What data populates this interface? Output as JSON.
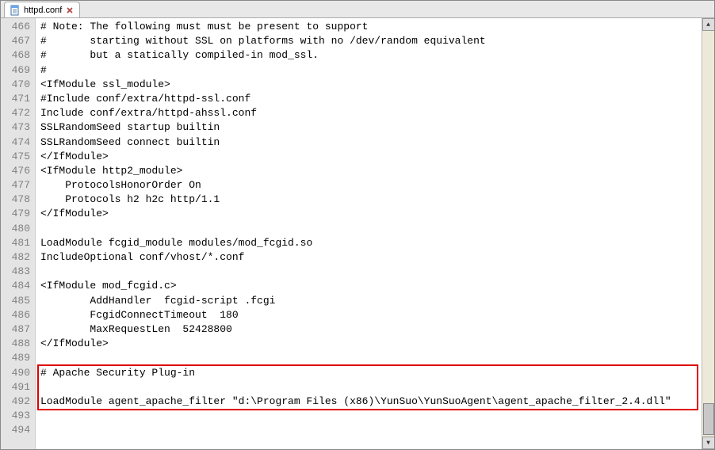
{
  "tab": {
    "filename": "httpd.conf"
  },
  "editor": {
    "first_line": 466,
    "highlight": {
      "from": 490,
      "to": 492
    },
    "lines": [
      "# Note: The following must must be present to support",
      "#       starting without SSL on platforms with no /dev/random equivalent",
      "#       but a statically compiled-in mod_ssl.",
      "#",
      "<IfModule ssl_module>",
      "#Include conf/extra/httpd-ssl.conf",
      "Include conf/extra/httpd-ahssl.conf",
      "SSLRandomSeed startup builtin",
      "SSLRandomSeed connect builtin",
      "</IfModule>",
      "<IfModule http2_module>",
      "    ProtocolsHonorOrder On",
      "    Protocols h2 h2c http/1.1",
      "</IfModule>",
      "",
      "LoadModule fcgid_module modules/mod_fcgid.so",
      "IncludeOptional conf/vhost/*.conf",
      "",
      "<IfModule mod_fcgid.c>",
      "        AddHandler  fcgid-script .fcgi",
      "        FcgidConnectTimeout  180",
      "        MaxRequestLen  52428800",
      "</IfModule>",
      "",
      "# Apache Security Plug-in",
      "",
      "LoadModule agent_apache_filter \"d:\\Program Files (x86)\\YunSuo\\YunSuoAgent\\agent_apache_filter_2.4.dll\"",
      "",
      ""
    ]
  }
}
